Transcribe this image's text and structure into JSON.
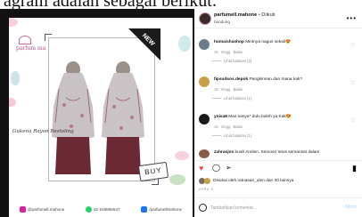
{
  "caption": {
    "text": "agram adalah sebagai berikut:"
  },
  "post": {
    "brand": "parfum ma",
    "badge_new": "NEW",
    "model_label": "Gukena Rayon Restoling",
    "buy_label": "BUY",
    "contacts": [
      {
        "text": "@parfumell.mahone",
        "icon": "instagram-icon",
        "color": "#d6249f"
      },
      {
        "text": "82 819888547",
        "icon": "whatsapp-icon",
        "color": "#25d366"
      },
      {
        "text": "/parfumellmahone",
        "icon": "facebook-icon",
        "color": "#1877f2"
      }
    ]
  },
  "header": {
    "username": "parfumell.mahone",
    "separator": "•",
    "follow_label": "Diikuti",
    "location": "bandung",
    "more_icon": "more-horizontal-icon"
  },
  "comments": [
    {
      "username": "humaishashop",
      "text": "Mintnya nagus sekali😍",
      "time": "16 mngg",
      "likes": "Balas",
      "replies": "Lihat balasan (2)",
      "avatar_color": "#6b7b8c"
    },
    {
      "username": "fipsudsos.depok",
      "text": "Pangkinnan dan mana kak?",
      "time": "16 mngg",
      "likes": "Balas",
      "replies": "Lihat balasan (1)",
      "avatar_color": "#c9a04a"
    },
    {
      "username": "ynisa8",
      "text": "Mas sanya* dulu boleh ya Kak😍",
      "time": "16 mngg",
      "likes": "Balas",
      "replies": "Lihat balasan (1)",
      "avatar_color": "#1a1a1a"
    },
    {
      "username": "zahrasjns",
      "text": "buah Amilen. Semoez tetus semansat dalam",
      "time": "",
      "likes": "",
      "replies": "",
      "avatar_color": "#8a5a44"
    }
  ],
  "actions": {
    "like_icon": "heart-filled-icon",
    "comment_icon": "comment-icon",
    "share_icon": "share-icon",
    "save_icon": "bookmark-icon",
    "like_color": "#ed4956"
  },
  "likes": {
    "text": "Disukai oleh ratnasari_ulen dan 30 lainnya"
  },
  "post_date": "APRIL 5",
  "add_comment": {
    "placeholder": "Tambahkan komentar...",
    "post_label": "Kirim"
  }
}
